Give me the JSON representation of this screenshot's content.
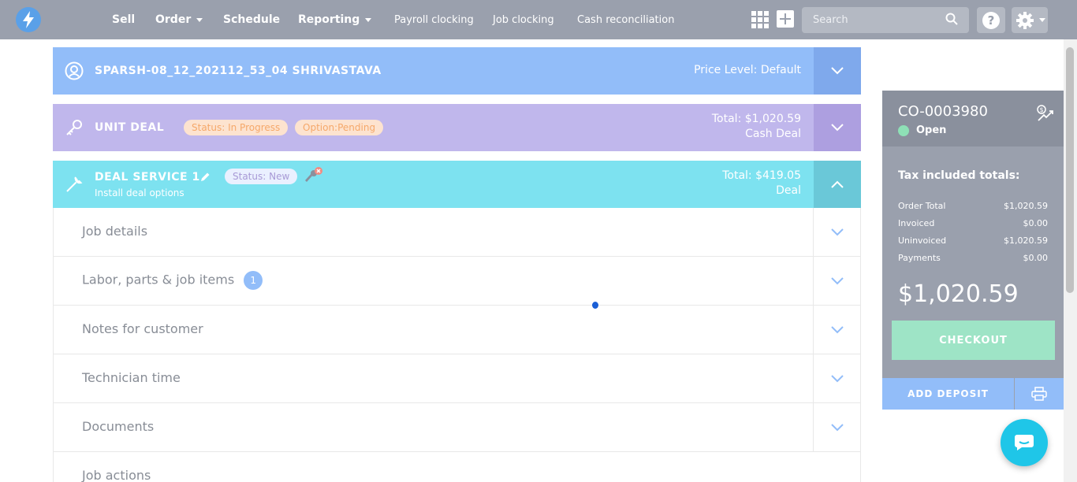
{
  "nav": {
    "items": [
      {
        "label": "Sell",
        "dropdown": false
      },
      {
        "label": "Order",
        "dropdown": true
      },
      {
        "label": "Schedule",
        "dropdown": false
      },
      {
        "label": "Reporting",
        "dropdown": true
      }
    ],
    "links": [
      "Payroll clocking",
      "Job clocking",
      "Cash reconciliation"
    ],
    "search_placeholder": "Search",
    "help_label": "?"
  },
  "customer_panel": {
    "name": "SPARSH-08_12_202112_53_04 SHRIVASTAVA",
    "price_level": "Price Level: Default"
  },
  "unit_panel": {
    "title": "UNIT DEAL",
    "status_badge": "Status: In Progress",
    "option_badge": "Option:Pending",
    "total": "Total: $1,020.59",
    "subtitle": "Cash Deal"
  },
  "service_panel": {
    "title": "DEAL SERVICE 1",
    "subtitle": "Install deal options",
    "status_badge": "Status: New",
    "total": "Total: $419.05",
    "type": "Deal"
  },
  "sections": [
    {
      "label": "Job details",
      "count": null
    },
    {
      "label": "Labor, parts & job items",
      "count": "1"
    },
    {
      "label": "Notes for customer",
      "count": null
    },
    {
      "label": "Technician time",
      "count": null
    },
    {
      "label": "Documents",
      "count": null
    },
    {
      "label": "Job actions",
      "count": null
    }
  ],
  "order_card": {
    "order_id": "CO-0003980",
    "status": "Open",
    "status_color": "#8ee0b6",
    "tax_title": "Tax included totals:",
    "totals": [
      {
        "label": "Order Total",
        "value": "$1,020.59"
      },
      {
        "label": "Invoiced",
        "value": "$0.00"
      },
      {
        "label": "Uninvoiced",
        "value": "$1,020.59"
      },
      {
        "label": "Payments",
        "value": "$0.00"
      }
    ],
    "grand_total": "$1,020.59",
    "checkout_label": "CHECKOUT",
    "deposit_label": "ADD DEPOSIT"
  },
  "colors": {
    "nav_bg": "#9aa0ad",
    "customer": "#92bdf9",
    "unit": "#c0b7ec",
    "service": "#7de2f0",
    "checkout": "#9ee4c6",
    "chat": "#1fc6e8"
  }
}
